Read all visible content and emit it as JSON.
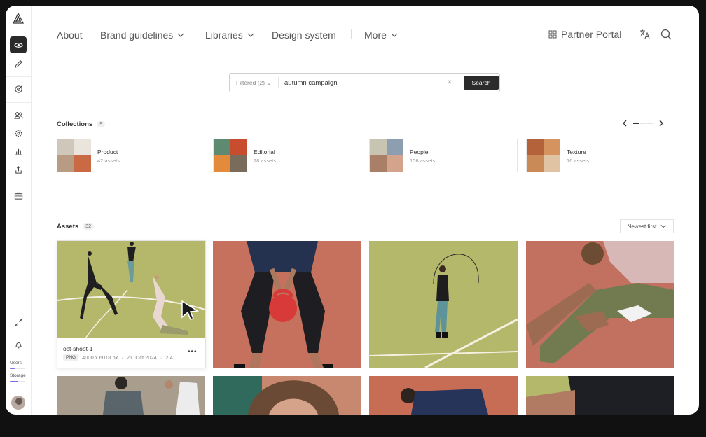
{
  "sidebar": {
    "logo": "triangle-logo",
    "items": [
      {
        "name": "eye-icon",
        "active": true
      },
      {
        "name": "pencil-icon",
        "active": false
      },
      {
        "name": "target-icon",
        "active": false
      },
      {
        "name": "users-icon",
        "active": false
      },
      {
        "name": "settings-icon",
        "active": false
      },
      {
        "name": "chart-icon",
        "active": false
      },
      {
        "name": "share-icon",
        "active": false
      },
      {
        "name": "briefcase-icon",
        "active": false
      }
    ],
    "bottom_icons": [
      "expand-icon",
      "bell-icon"
    ],
    "users_label": "Users",
    "users_fill": 0.3,
    "storage_label": "Storage",
    "storage_fill": 0.55,
    "accent": "#7a6cf0"
  },
  "nav": {
    "about": "About",
    "brand": "Brand guidelines",
    "libraries": "Libraries",
    "design": "Design system",
    "more": "More",
    "partner": "Partner Portal"
  },
  "search": {
    "filter": "Filtered (2)",
    "value": "autumn campaign",
    "clear": "×",
    "button": "Search"
  },
  "collections": {
    "title": "Collections",
    "count": "9",
    "items": [
      {
        "name": "Product",
        "count": "42 assets"
      },
      {
        "name": "Editorial",
        "count": "28 assets"
      },
      {
        "name": "People",
        "count": "106 assets"
      },
      {
        "name": "Texture",
        "count": "16 assets"
      }
    ]
  },
  "assets": {
    "title": "Assets",
    "count": "32",
    "sort": "Newest first",
    "card": {
      "name": "oct-shoot-1",
      "type": "PNG",
      "dims": "4000 x 6018 px",
      "date": "21. Oct 2024",
      "extra": "2.4...",
      "menu": "•••"
    }
  },
  "colors": {
    "court_green": "#b4b86a",
    "court_red": "#c5705e",
    "dark": "#2b2b2b"
  }
}
